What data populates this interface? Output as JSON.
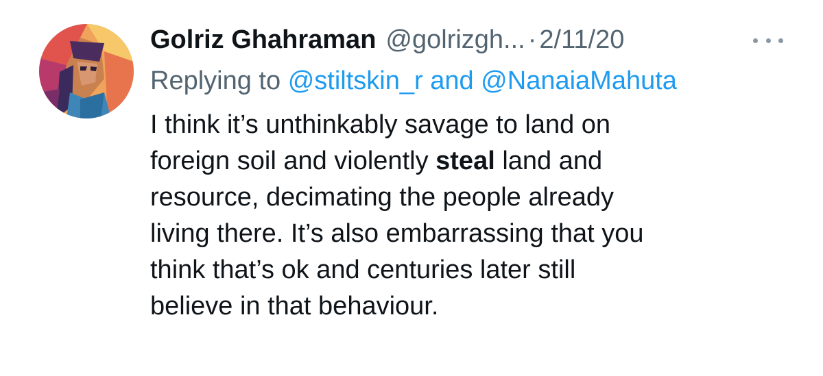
{
  "tweet": {
    "author": {
      "display_name": "Golriz Ghahraman",
      "handle": "@golrizgh...",
      "avatar_icon": "profile-avatar"
    },
    "separator": "·",
    "date": "2/11/20",
    "more_icon": "more-options-icon",
    "reply_context": {
      "prefix": "Replying to",
      "mentions": [
        "@stiltskin_r",
        "@NanaiaMahuta"
      ],
      "joiner": "and"
    },
    "body": {
      "lines": [
        {
          "text": "I think it’s unthinkably savage to land on"
        },
        {
          "before": "foreign soil and violently ",
          "bold": "steal",
          "after": " land and"
        },
        {
          "text": "resource, decimating the people already"
        },
        {
          "text": "living there. It’s also embarrassing that you"
        },
        {
          "text": "think that’s ok and centuries later still"
        },
        {
          "text": "believe in that behaviour."
        }
      ]
    },
    "colors": {
      "text": "#0f1419",
      "secondary": "#536471",
      "link": "#1d9bf0"
    }
  }
}
